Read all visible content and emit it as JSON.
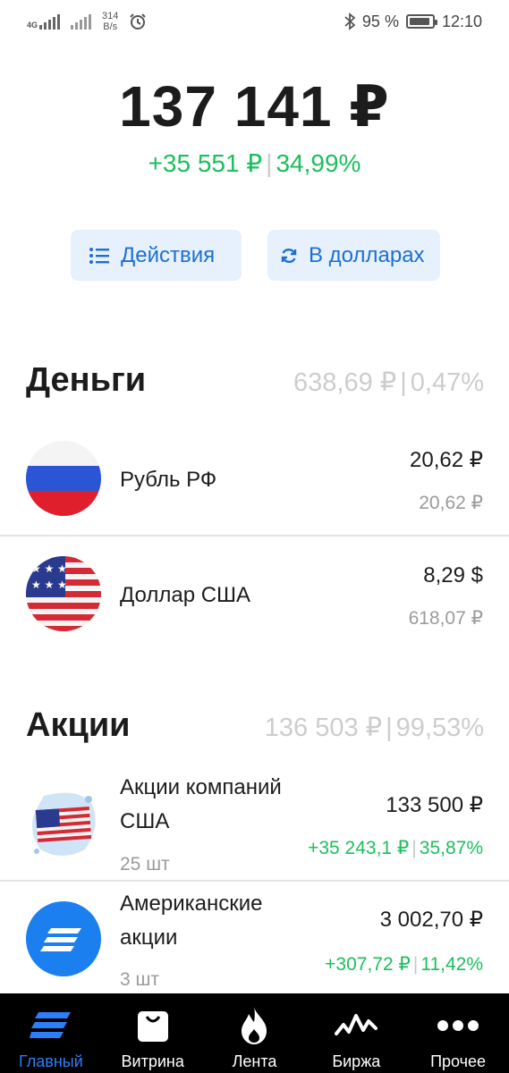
{
  "status_bar": {
    "network": "4G",
    "speed_value": "314",
    "speed_unit": "B/s",
    "battery": "95 %",
    "time": "12:10"
  },
  "portfolio": {
    "total": "137 141 ₽",
    "gain_abs": "+35 551 ₽",
    "gain_pct": "34,99%"
  },
  "buttons": {
    "actions_label": "Действия",
    "usd_label": "В долларах"
  },
  "money": {
    "title": "Деньги",
    "sum": "638,69 ₽",
    "pct": "0,47%",
    "items": [
      {
        "name": "Рубль РФ",
        "value": "20,62 ₽",
        "sub": "20,62 ₽"
      },
      {
        "name": "Доллар США",
        "value": "8,29 $",
        "sub": "618,07 ₽"
      }
    ]
  },
  "stocks": {
    "title": "Акции",
    "sum": "136 503 ₽",
    "pct": "99,53%",
    "items": [
      {
        "name_line1": "Акции компаний",
        "name_line2": "США",
        "qty": "25 шт",
        "value": "133 500 ₽",
        "gain_abs": "+35 243,1 ₽",
        "gain_pct": "35,87%"
      },
      {
        "name_line1": "Американские",
        "name_line2": "акции",
        "qty": "3 шт",
        "value": "3 002,70 ₽",
        "gain_abs": "+307,72 ₽",
        "gain_pct": "11,42%"
      }
    ]
  },
  "tabs": [
    {
      "label": "Главный",
      "icon": "home-stripes-icon",
      "active": true
    },
    {
      "label": "Витрина",
      "icon": "shopping-bag-icon",
      "active": false
    },
    {
      "label": "Лента",
      "icon": "flame-icon",
      "active": false
    },
    {
      "label": "Биржа",
      "icon": "pulse-chart-icon",
      "active": false
    },
    {
      "label": "Прочее",
      "icon": "more-dots-icon",
      "active": false
    }
  ],
  "colors": {
    "accent": "#1e6fd1",
    "positive": "#1cbf5c",
    "tab_active": "#2d7ff9"
  }
}
